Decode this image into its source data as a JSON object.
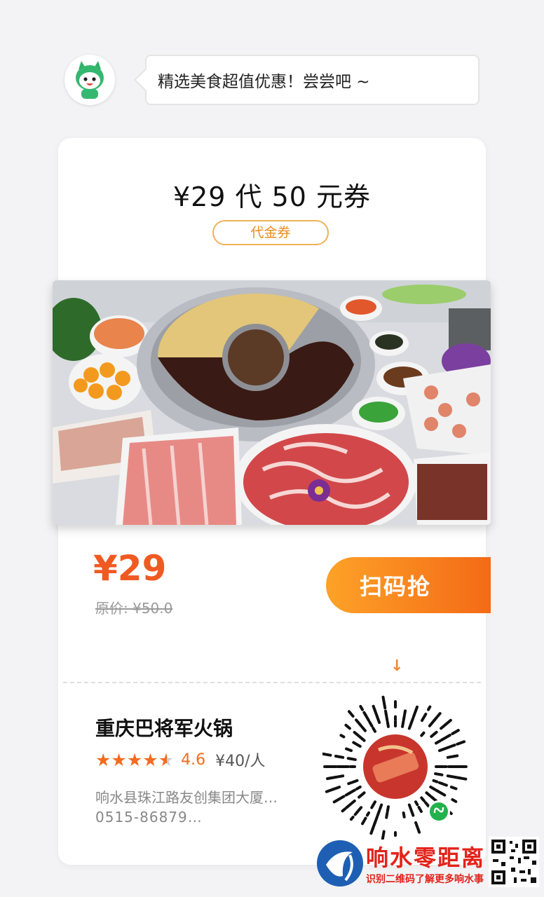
{
  "bubble": {
    "text": "精选美食超值优惠！尝尝吧 ~"
  },
  "coupon": {
    "title": "¥29 代 50 元券",
    "tag": "代金券",
    "price": "¥29",
    "original_price": "原价: ¥50.0",
    "scan_button": "扫码抢"
  },
  "store": {
    "name": "重庆巴将军火锅",
    "rating": "4.6",
    "rating_value": 4.6,
    "per_person": "¥40/人",
    "address": "响水县珠江路友创集团大厦…",
    "phone": "0515-86879…"
  },
  "watermark": {
    "title": "响水零距离",
    "subtitle": "识别二维码了解更多响水事"
  },
  "icons": [
    "mascot-avatar-icon",
    "down-arrow-icon",
    "star-icon",
    "mini-program-icon",
    "qr-code-icon"
  ],
  "colors": {
    "accent": "#f36c20",
    "tag_border": "#f0b25a",
    "watermark": "#e2231a"
  }
}
